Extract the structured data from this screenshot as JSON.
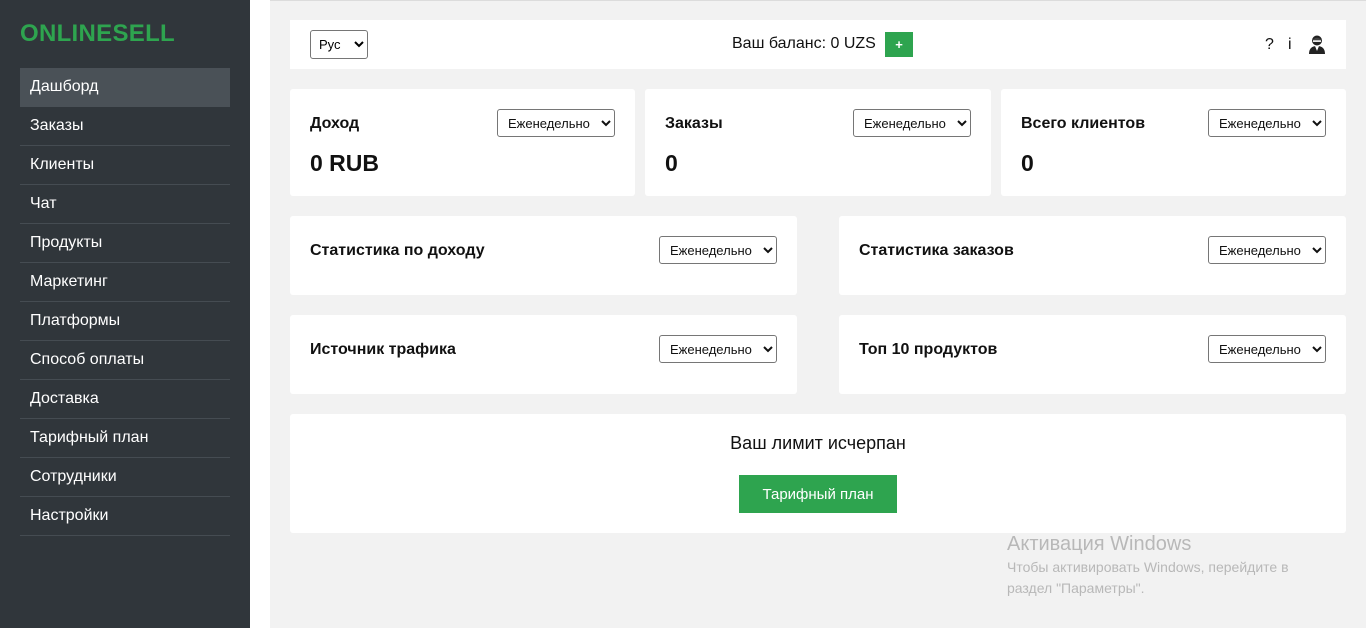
{
  "app": {
    "logo": "ONLINESELL"
  },
  "sidebar": {
    "items": [
      {
        "label": "Дашборд"
      },
      {
        "label": "Заказы"
      },
      {
        "label": "Клиенты"
      },
      {
        "label": "Чат"
      },
      {
        "label": "Продукты"
      },
      {
        "label": "Маркетинг"
      },
      {
        "label": "Платформы"
      },
      {
        "label": "Способ оплаты"
      },
      {
        "label": "Доставка"
      },
      {
        "label": "Тарифный план"
      },
      {
        "label": "Сотрудники"
      },
      {
        "label": "Настройки"
      }
    ],
    "active": "Дашборд"
  },
  "header": {
    "language": "Рус",
    "balance_text": "Ваш баланс: 0 UZS",
    "add_label": "+",
    "help_icon": "?",
    "info_icon": "i",
    "user_icon": "user-icon"
  },
  "period_option": "Еженедельно",
  "stats": {
    "income": {
      "title": "Доход",
      "value": "0 RUB"
    },
    "orders": {
      "title": "Заказы",
      "value": "0"
    },
    "clients": {
      "title": "Всего клиентов",
      "value": "0"
    }
  },
  "panels": {
    "income_stats": {
      "title": "Статистика по доходу"
    },
    "order_stats": {
      "title": "Статистика заказов"
    },
    "traffic_source": {
      "title": "Источник трафика"
    },
    "top_products": {
      "title": "Топ 10 продуктов"
    }
  },
  "limit": {
    "message": "Ваш лимит исчерпан",
    "button_label": "Тарифный план"
  },
  "watermark": {
    "title": "Активация Windows",
    "text": "Чтобы активировать Windows, перейдите в раздел \"Параметры\"."
  },
  "colors": {
    "accent": "#2ea44f",
    "sidebar": "#30363b",
    "sidebar_active": "#4a5157"
  }
}
